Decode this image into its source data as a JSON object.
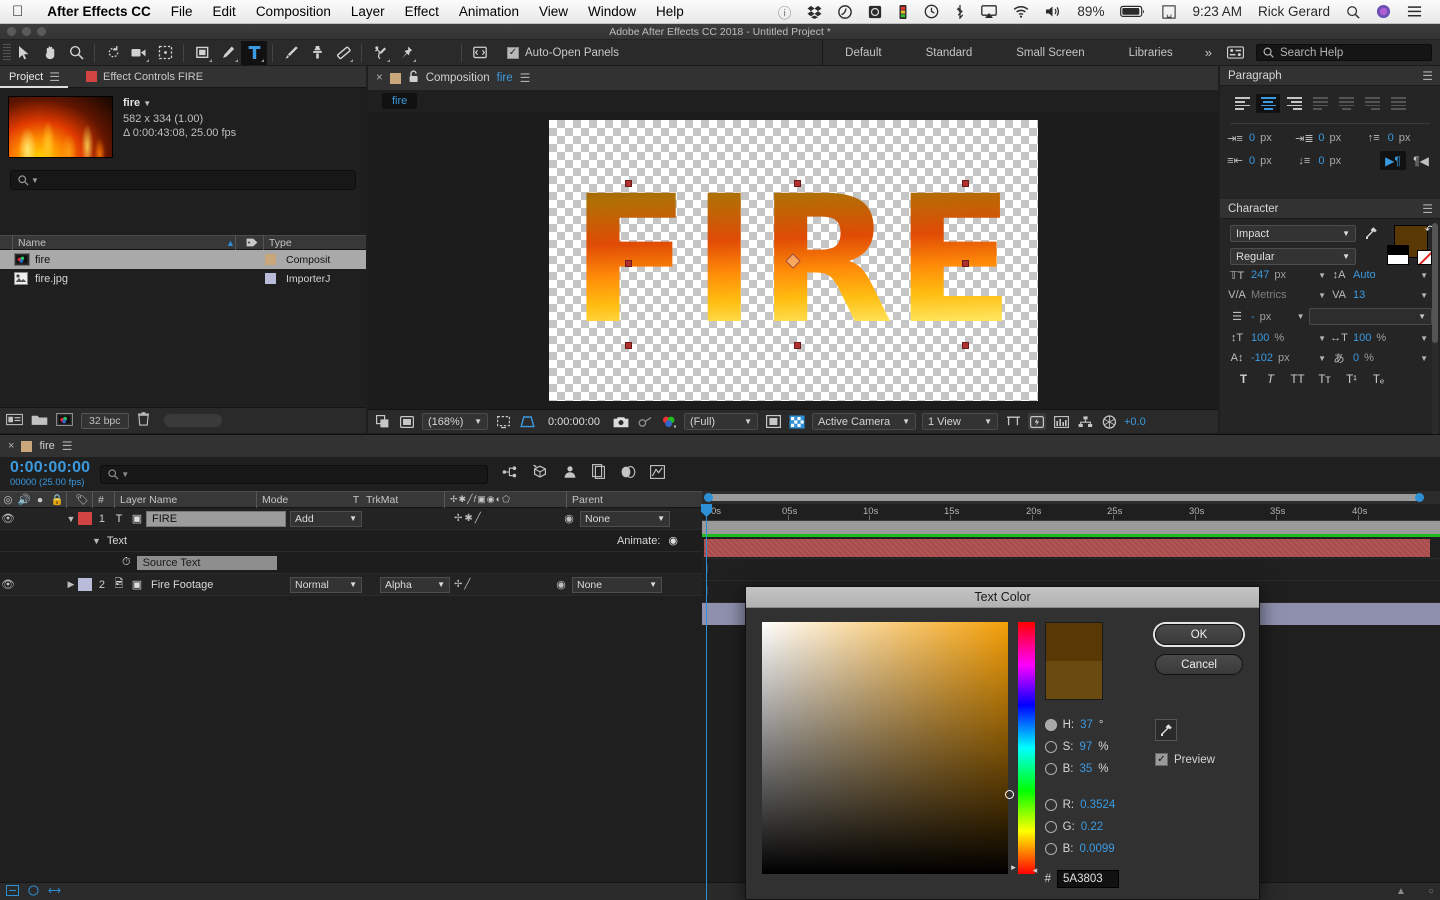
{
  "macbar": {
    "apple_icon": "apple-icon",
    "app_name": "After Effects CC",
    "menus": [
      "File",
      "Edit",
      "Composition",
      "Layer",
      "Effect",
      "Animation",
      "View",
      "Window",
      "Help"
    ],
    "status_icons": [
      "dropbox-icon",
      "cloud-icon",
      "nvidia-icon",
      "meter-icon",
      "timemachine-icon",
      "bluetooth-icon",
      "airplay-icon",
      "wifi-icon",
      "volume-icon"
    ],
    "battery_percent": "89%",
    "input_menu_icon": "keyboard-input-icon",
    "clock": "9:23 AM",
    "user": "Rick Gerard",
    "spotlight_icon": "search-icon",
    "siri_icon": "siri-icon",
    "notification_icon": "notification-center-icon"
  },
  "titlebar": {
    "title": "Adobe After Effects CC 2018 - Untitled Project *"
  },
  "toolbar": {
    "tools": [
      "selection-tool",
      "hand-tool",
      "zoom-tool",
      "rotation-tool",
      "camera-tool",
      "anchor-point-tool",
      "shape-tool",
      "pen-tool",
      "type-tool",
      "brush-tool",
      "clone-stamp-tool",
      "eraser-tool",
      "roto-brush-tool",
      "puppet-pin-tool"
    ],
    "selected_tool": "type-tool",
    "panel_toggle_icon": "open-panel-icon",
    "auto_open_panels_label": "Auto-Open Panels",
    "auto_open_panels_checked": true,
    "workspaces": [
      "Default",
      "Standard",
      "Small Screen",
      "Libraries"
    ],
    "workspace_overflow": "»",
    "workspace_menu_icon": "workspace-menu-icon",
    "search_placeholder": "Search Help"
  },
  "project": {
    "tabs": [
      {
        "label": "Project",
        "active": true,
        "icon": ""
      },
      {
        "label": "Effect Controls FIRE",
        "active": false,
        "icon": "comp-swatch"
      }
    ],
    "item_name": "fire",
    "item_size": "582 x 334 (1.00)",
    "item_duration": "Δ 0:00:43:08, 25.00 fps",
    "search_placeholder": "",
    "columns": [
      "Name",
      "Type"
    ],
    "sort_icon": "sort-ascending-icon",
    "label_icon": "label-tag-icon",
    "rows": [
      {
        "name": "fire",
        "type": "Composit",
        "icon": "composition-icon",
        "swatch": "#c8a87a",
        "selected": true
      },
      {
        "name": "fire.jpg",
        "type": "ImporterJ",
        "icon": "image-file-icon",
        "swatch": "#b9bcd8",
        "selected": false
      }
    ],
    "footer": {
      "icons": [
        "interpret-footage-icon",
        "new-folder-icon",
        "new-comp-icon",
        "delete-icon"
      ],
      "bit_depth": "32 bpc"
    }
  },
  "composition": {
    "close_icon": "close-icon",
    "swatch_color": "#c8a87a",
    "lock_icon": "lock-icon",
    "tab_prefix": "Composition",
    "tab_name": "fire",
    "breadcrumb": "fire",
    "artwork_text": "FIRE",
    "footer": {
      "toggle_icons": [
        "region-of-interest-icon",
        "grid-guides-icon"
      ],
      "zoom": "(168%)",
      "timecode": "0:00:00:00",
      "snapshot_icon": "snapshot-camera-icon",
      "show_snapshot_icon": "show-snapshot-icon",
      "channels_icon": "channels-icon",
      "resolution": "(Full)",
      "transparency_grid_icon": "transparency-grid-icon",
      "mask_icon": "mask-toggle-icon",
      "camera": "Active Camera",
      "views": "1 View",
      "pixel_aspect_icon": "pixel-aspect-icon",
      "fast_preview_icon": "fast-preview-icon",
      "timeline_icon": "timeline-icon",
      "flowchart_icon": "flowchart-icon",
      "exposure_icon": "exposure-icon",
      "exposure_value": "+0.0"
    }
  },
  "paragraph": {
    "title": "Paragraph",
    "menu_icon": "panel-menu-icon",
    "align_buttons": [
      "align-left",
      "align-center",
      "align-right",
      "justify-last-left",
      "justify-last-center",
      "justify-last-right",
      "justify-all"
    ],
    "align_active_index": 1,
    "indents": [
      {
        "icon": "indent-left-icon",
        "value": "0",
        "unit": "px"
      },
      {
        "icon": "indent-first-line-icon",
        "value": "0",
        "unit": "px"
      },
      {
        "icon": "space-before-icon",
        "value": "0",
        "unit": "px"
      },
      {
        "icon": "indent-right-icon",
        "value": "0",
        "unit": "px"
      },
      {
        "icon": "indent-last-icon",
        "value": "0",
        "unit": "px"
      }
    ],
    "direction_ltr_icon": "text-direction-ltr-icon",
    "direction_rtl_icon": "text-direction-rtl-icon"
  },
  "character": {
    "title": "Character",
    "menu_icon": "panel-menu-icon",
    "font_family": "Impact",
    "font_style": "Regular",
    "eyedropper_icon": "eyedropper-icon",
    "fill_color": "#5A3803",
    "swap_icon": "swap-colors-icon",
    "font_size": "247",
    "font_size_unit": "px",
    "leading": "Auto",
    "kerning": "Metrics",
    "tracking": "13",
    "stroke_width": "-",
    "stroke_width_unit": "px",
    "stroke_style": "",
    "vertical_scale": "100",
    "horizontal_scale": "100",
    "baseline_shift": "-102",
    "baseline_shift_unit": "px",
    "tsume": "0",
    "percent": "%",
    "style_buttons": [
      "faux-bold",
      "faux-italic",
      "all-caps",
      "small-caps",
      "superscript",
      "subscript"
    ]
  },
  "timeline": {
    "close_icon": "close-icon",
    "swatch_color": "#c8a87a",
    "tab_name": "fire",
    "menu_icon": "panel-menu-icon",
    "current_time": "0:00:00:00",
    "frame_info": "00000 (25.00 fps)",
    "search_placeholder": "",
    "switch_icons": [
      "composition-mini-flowchart-icon",
      "draft-3d-icon",
      "hide-shy-layers-icon",
      "frame-blending-icon",
      "motion-blur-icon",
      "graph-editor-icon"
    ],
    "columns": [
      "Layer Name",
      "Mode",
      "T",
      "TrkMat",
      "Parent"
    ],
    "column_icons": [
      "video-eye-icon",
      "audio-icon",
      "solo-icon",
      "lock-icon",
      "label-icon",
      "number-icon"
    ],
    "switch_header_icons": [
      "shy-icon",
      "collapse-icon",
      "quality-icon",
      "effects-fx-icon",
      "frame-blend-icon",
      "motion-blur-icon",
      "adjustment-icon",
      "3d-layer-icon"
    ],
    "layers": [
      {
        "index": "1",
        "name": "FIRE",
        "mode": "Add",
        "trkmat": "",
        "parent": "None",
        "label_color": "#d04444",
        "type_icon": "text-layer-icon",
        "expanded": true,
        "bar_color": "#b25555"
      },
      {
        "index": "2",
        "name": "Fire Footage",
        "mode": "Normal",
        "trkmat": "Alpha",
        "parent": "None",
        "label_color": "#b9bcd8",
        "type_icon": "footage-layer-icon",
        "expanded": false,
        "bar_color": "#8e90ad"
      }
    ],
    "text_group_label": "Text",
    "animate_label": "Animate:",
    "source_text_label": "Source Text",
    "ruler_ticks": [
      "0s",
      "05s",
      "10s",
      "15s",
      "20s",
      "25s",
      "30s",
      "35s",
      "40s"
    ]
  },
  "dialog": {
    "title": "Text Color",
    "ok_label": "OK",
    "cancel_label": "Cancel",
    "eyedropper_icon": "eyedropper-icon",
    "preview_label": "Preview",
    "preview_checked": true,
    "hsb": [
      {
        "label": "H:",
        "value": "37",
        "unit": "°",
        "selected": true
      },
      {
        "label": "S:",
        "value": "97",
        "unit": "%",
        "selected": false
      },
      {
        "label": "B:",
        "value": "35",
        "unit": "%",
        "selected": false
      }
    ],
    "rgb": [
      {
        "label": "R:",
        "value": "0.3524",
        "unit": "",
        "selected": false
      },
      {
        "label": "G:",
        "value": "0.22",
        "unit": "",
        "selected": false
      },
      {
        "label": "B:",
        "value": "0.0099",
        "unit": "",
        "selected": false
      }
    ],
    "hex_symbol": "#",
    "hex_value": "5A3803",
    "swatch_new": "#5A3803",
    "swatch_current": "#6b4a12"
  }
}
